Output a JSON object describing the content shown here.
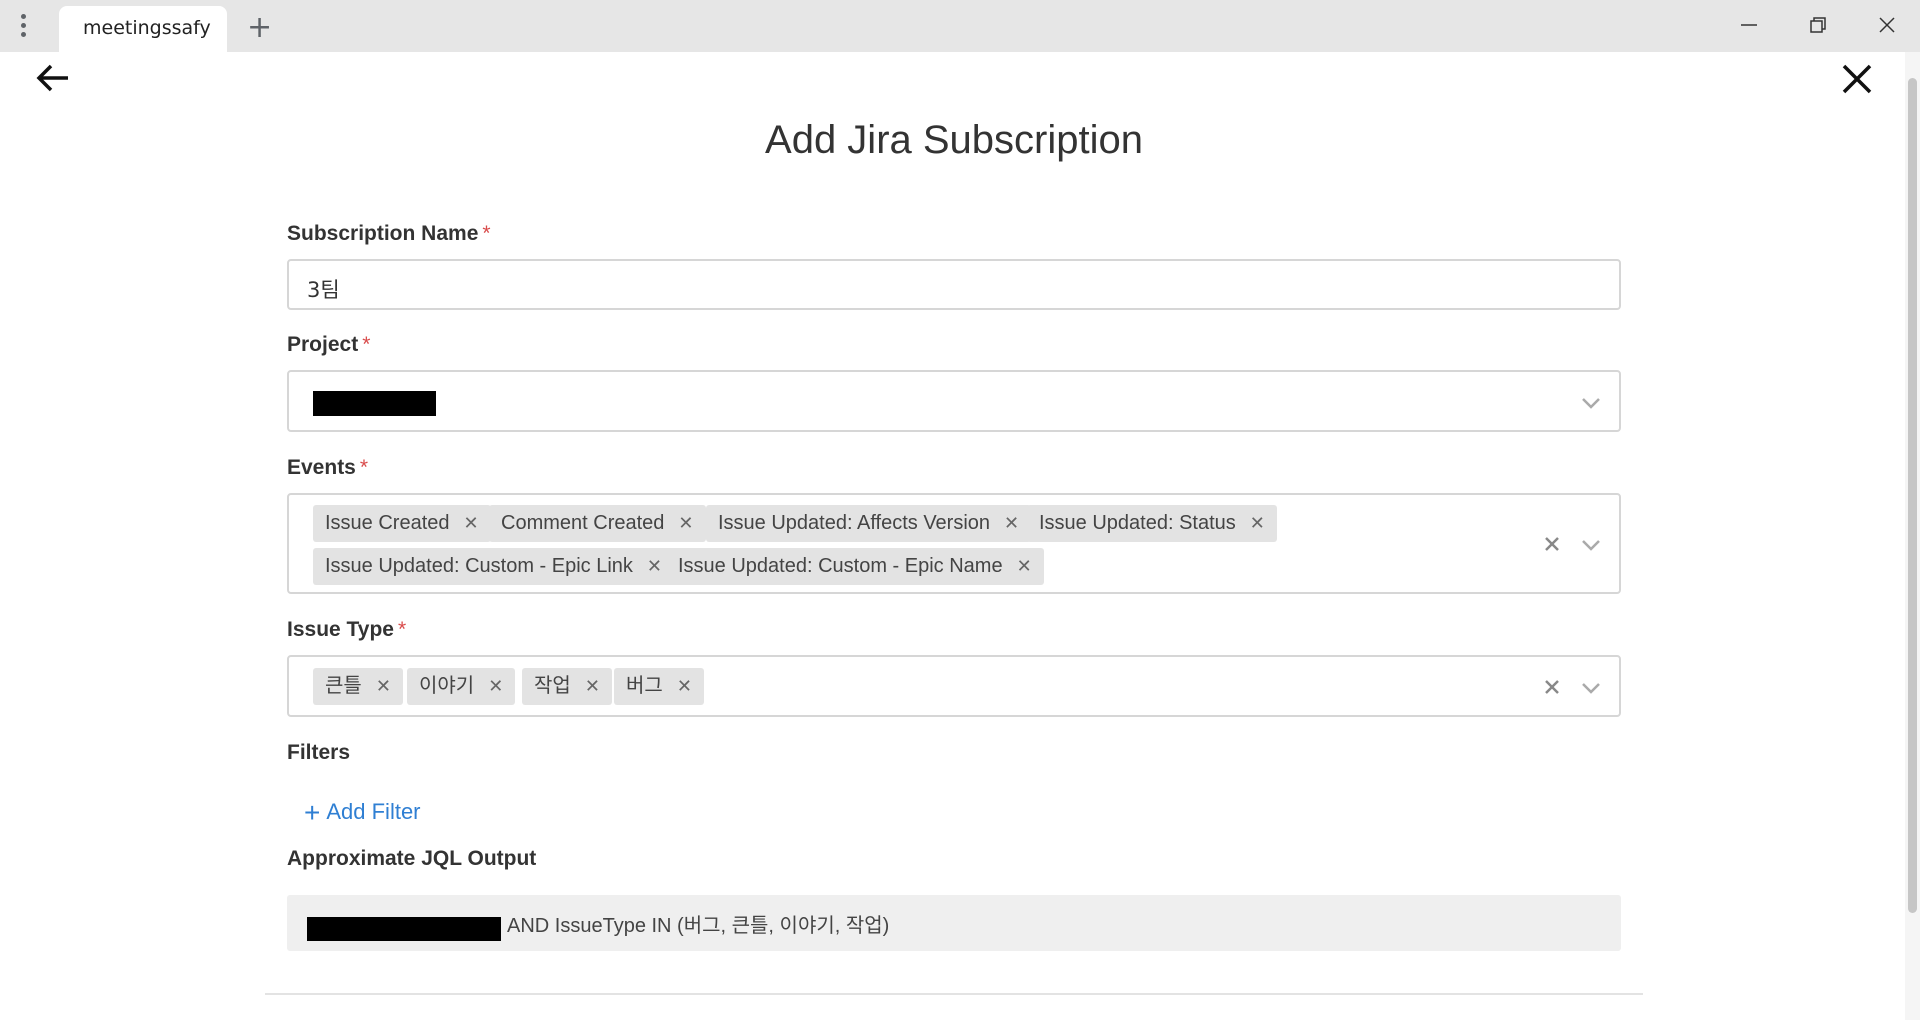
{
  "browser": {
    "tab_title": "meetingssafy",
    "icons": [
      "more-vertical-icon",
      "plus-icon",
      "minimize-icon",
      "restore-icon",
      "close-icon"
    ]
  },
  "page": {
    "title": "Add Jira Subscription",
    "back_icon": "arrow-left-icon",
    "close_icon": "close-icon"
  },
  "form": {
    "subscription_name": {
      "label": "Subscription Name",
      "required_mark": "*",
      "value": "3팀"
    },
    "project": {
      "label": "Project",
      "required_mark": "*",
      "value_redacted": true
    },
    "events": {
      "label": "Events",
      "required_mark": "*",
      "tags": [
        "Issue Created",
        "Comment Created",
        "Issue Updated: Affects Version",
        "Issue Updated: Status",
        "Issue Updated: Custom - Epic Link",
        "Issue Updated: Custom - Epic Name"
      ]
    },
    "issue_type": {
      "label": "Issue Type",
      "required_mark": "*",
      "tags": [
        "큰틀",
        "이야기",
        "작업",
        "버그"
      ]
    },
    "filters": {
      "label": "Filters",
      "add_label": "Add Filter"
    },
    "jql": {
      "label": "Approximate JQL Output",
      "visible_text": "AND IssueType IN (버그, 큰틀, 이야기, 작업)"
    }
  },
  "colors": {
    "required": "#d94b4b",
    "link": "#2f7fd3",
    "tag_bg": "#e3e3e3"
  }
}
